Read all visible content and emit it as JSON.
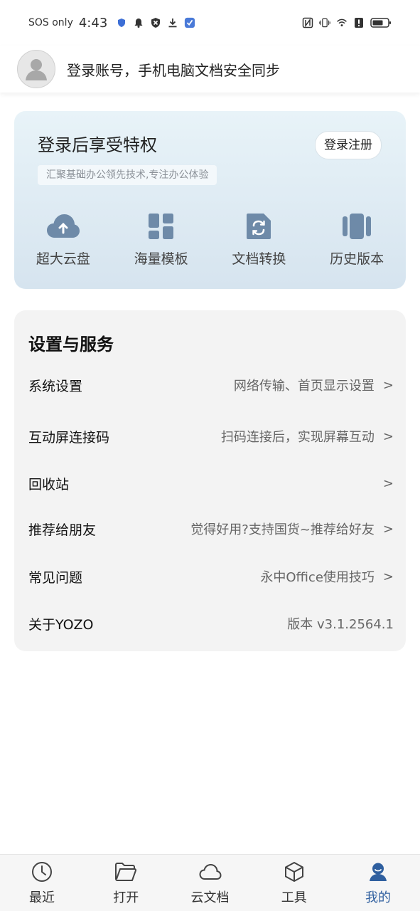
{
  "status_bar": {
    "carrier": "SOS only",
    "time": "4:43",
    "icons_left": [
      "shield-icon",
      "bell-icon",
      "blocked-icon",
      "download-icon",
      "app-icon"
    ],
    "icons_right": [
      "nfc-icon",
      "vibrate-icon",
      "wifi-icon",
      "alert-icon",
      "battery-icon"
    ]
  },
  "header": {
    "prompt": "登录账号，手机电脑文档安全同步"
  },
  "privilege_card": {
    "title": "登录后享受特权",
    "subtitle": "汇聚基础办公领先技术,专注办公体验",
    "login_button": "登录注册",
    "features": [
      {
        "label": "超大云盘",
        "icon": "cloud-upload-icon"
      },
      {
        "label": "海量模板",
        "icon": "template-grid-icon"
      },
      {
        "label": "文档转换",
        "icon": "document-convert-icon"
      },
      {
        "label": "历史版本",
        "icon": "history-version-icon"
      }
    ]
  },
  "settings": {
    "title": "设置与服务",
    "rows": [
      {
        "label": "系统设置",
        "value": "网络传输、首页显示设置",
        "chevron": ">"
      },
      {
        "label": "互动屏连接码",
        "value": "扫码连接后，实现屏幕互动",
        "chevron": ">"
      },
      {
        "label": "回收站",
        "value": "",
        "chevron": ">"
      },
      {
        "label": "推荐给朋友",
        "value": "觉得好用?支持国货~推荐给好友",
        "chevron": ">"
      },
      {
        "label": "常见问题",
        "value": "永中Office使用技巧",
        "chevron": ">"
      },
      {
        "label": "关于YOZO",
        "value": "版本 v3.1.2564.1",
        "chevron": ""
      }
    ]
  },
  "bottom_nav": {
    "items": [
      {
        "label": "最近",
        "icon": "clock-icon",
        "active": false
      },
      {
        "label": "打开",
        "icon": "folder-open-icon",
        "active": false
      },
      {
        "label": "云文档",
        "icon": "cloud-icon",
        "active": false
      },
      {
        "label": "工具",
        "icon": "cube-icon",
        "active": false
      },
      {
        "label": "我的",
        "icon": "profile-icon",
        "active": true
      }
    ]
  },
  "colors": {
    "accent": "#2f5f9f",
    "feature_icon": "#6e8aa8",
    "card_bg_top": "#e8f3f8",
    "card_bg_bottom": "#d6e4ef",
    "settings_bg": "#f3f3f3"
  }
}
